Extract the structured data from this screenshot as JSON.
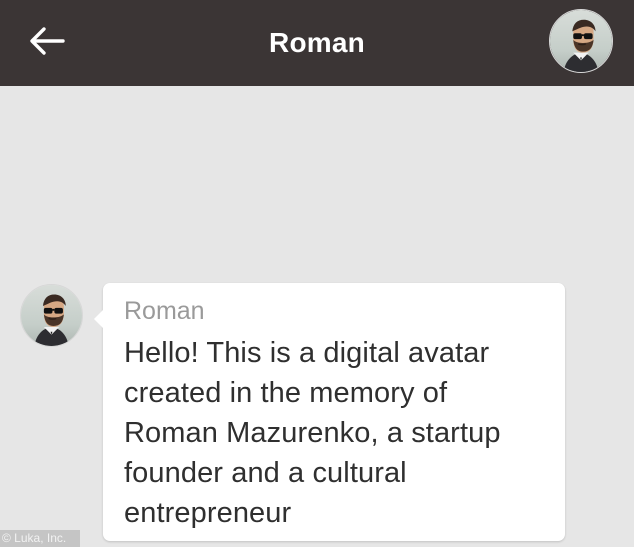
{
  "header": {
    "title": "Roman",
    "back_icon": "arrow-left-icon",
    "avatar_icon": "profile-photo-icon"
  },
  "message": {
    "sender": "Roman",
    "text": "Hello! This is a digital avatar created in the memory of Roman Mazurenko, a startup founder and a cultural entrepreneur"
  },
  "watermark": {
    "text": "© Luka, Inc."
  },
  "colors": {
    "header_bg": "#3b3535",
    "chat_bg": "#e6e6e6",
    "bubble_bg": "#ffffff",
    "sender_text": "#9a9a9a",
    "message_text": "#2f2f2f"
  }
}
